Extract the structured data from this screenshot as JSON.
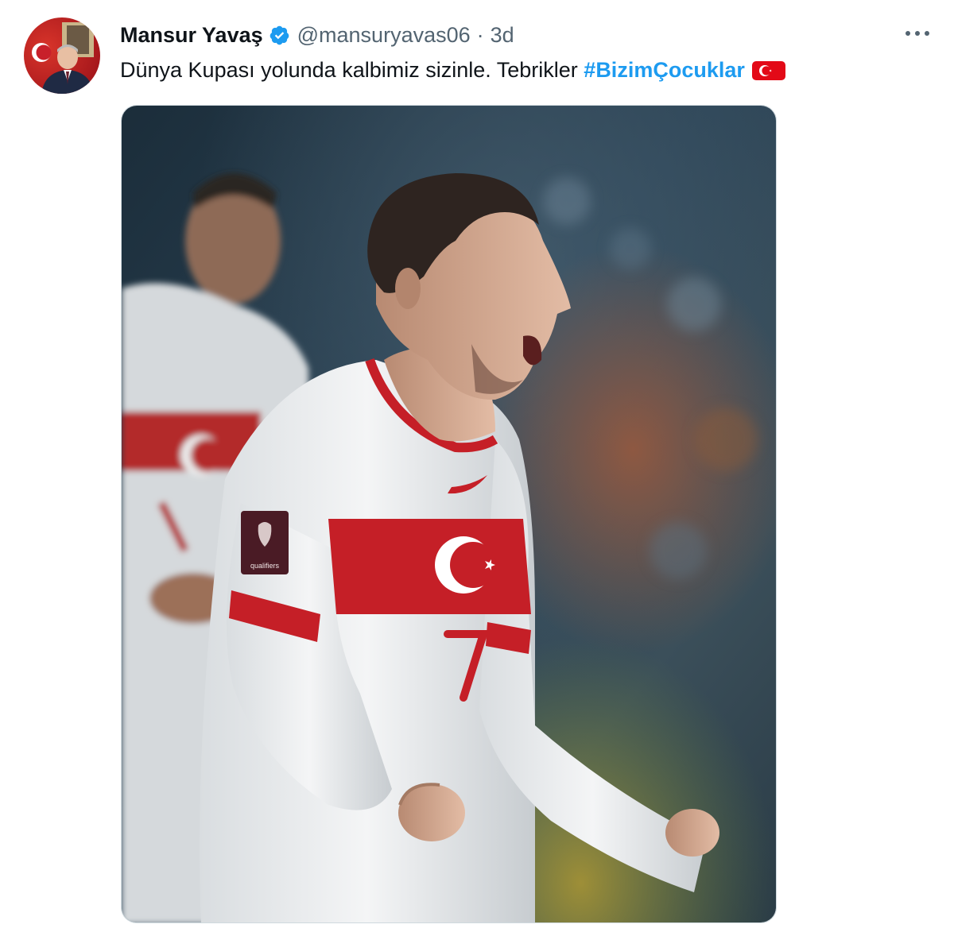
{
  "tweet": {
    "display_name": "Mansur Yavaş",
    "handle": "@mansuryavas06",
    "separator": "·",
    "time": "3d",
    "text_main": "Dünya Kupası yolunda kalbimiz sizinle. Tebrikler ",
    "hashtag": "#BizimÇocuklar",
    "verified_icon": "verified-badge-icon",
    "flag_icon": "turkey-flag-emoji",
    "more_icon": "more-options-icon"
  },
  "photo": {
    "description_icon": "football-player-celebration-photo",
    "jersey_number": "7",
    "badge_text": "qualifiers"
  },
  "colors": {
    "link": "#1d9bf0",
    "secondary_text": "#536471",
    "primary_text": "#0f1419",
    "verified": "#1d9bf0",
    "turkey_red": "#e30a17"
  }
}
